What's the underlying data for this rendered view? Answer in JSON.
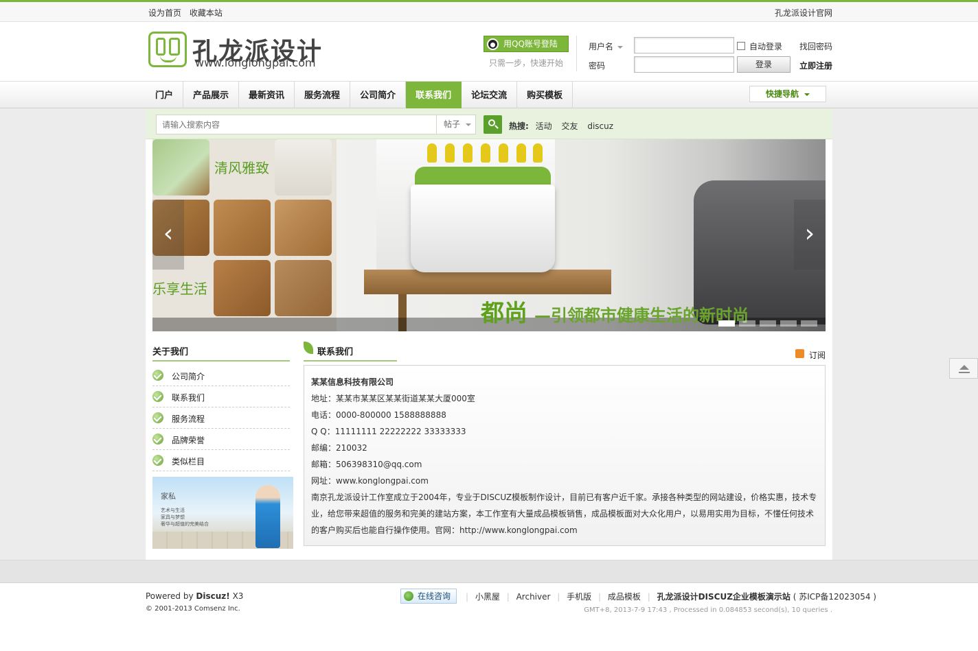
{
  "topbar": {
    "set_home": "设为首页",
    "bookmark": "收藏本站",
    "official": "孔龙派设计官网"
  },
  "logo": {
    "title": "孔龙派设计",
    "url": "www.longlongpai.com"
  },
  "login": {
    "qq_button": "用QQ账号登陆",
    "qq_tip": "只需一步，快速开始",
    "username_label": "用户名",
    "password_label": "密码",
    "auto_login": "自动登录",
    "login_button": "登录",
    "find_password": "找回密码",
    "register": "立即注册"
  },
  "nav": {
    "items": [
      {
        "label": "门户",
        "active": false
      },
      {
        "label": "产品展示",
        "active": false
      },
      {
        "label": "最新资讯",
        "active": false
      },
      {
        "label": "服务流程",
        "active": false
      },
      {
        "label": "公司简介",
        "active": false
      },
      {
        "label": "联系我们",
        "active": true
      },
      {
        "label": "论坛交流",
        "active": false
      },
      {
        "label": "购买模板",
        "active": false
      }
    ],
    "quick_nav": "快捷导航"
  },
  "search": {
    "placeholder": "请输入搜索内容",
    "type": "帖子",
    "hot_label": "热搜:",
    "hot": [
      "活动",
      "交友",
      "discuz"
    ]
  },
  "banner": {
    "text_left_1": "清风雅致",
    "text_left_2": "乐享生活",
    "caption_main": "都尚",
    "caption_sub": "—引领都市健康生活的新时尚",
    "slides": 5,
    "active_slide": 1
  },
  "sidebar": {
    "title": "关于我们",
    "items": [
      "公司简介",
      "联系我们",
      "服务流程",
      "品牌荣誉",
      "类似栏目"
    ],
    "ad": {
      "title": "家私",
      "lines": [
        "艺术与生活",
        "家具与梦想",
        "奢华与超值的完美结合"
      ]
    }
  },
  "content": {
    "title": "联系我们",
    "subscribe": "订阅",
    "company": "某某信息科技有限公司",
    "lines": [
      "地址：某某市某某区某某街道某某大厦000室",
      "电话：0000-800000 1588888888",
      "Q  Q：11111111  22222222 33333333",
      "邮编：210032",
      "邮箱：506398310@qq.com",
      "网址：www.konglongpai.com"
    ],
    "intro": "南京孔龙派设计工作室成立于2004年，专业于DISCUZ模板制作设计，目前已有客户近千家。承接各种类型的网站建设，价格实惠，技术专业，给您带来超值的服务和完美的建站方案，本工作室有大量成品模板销售，成品模板面对大众化用户，以易用实用为目标，不懂任何技术的客户购买后也能自行操作使用。官网：http://www.konglongpai.com"
  },
  "footer": {
    "powered_prefix": "Powered by",
    "powered_brand": "Discuz!",
    "powered_ver": "X3",
    "copyright": "© 2001-2013 Comsenz Inc.",
    "consult": "在线咨询",
    "links": [
      "小黑屋",
      "Archiver",
      "手机版",
      "成品模板"
    ],
    "site_name": "孔龙派设计DISCUZ企业模板演示站",
    "icp": "( 苏ICP备12023054 )",
    "gmt": "GMT+8, 2013-7-9 17:43 , Processed in 0.084853 second(s), 10 queries ."
  },
  "colors": {
    "accent": "#7cb63a",
    "accent_dark": "#5aa02a",
    "search_bg": "#e8f2df"
  }
}
